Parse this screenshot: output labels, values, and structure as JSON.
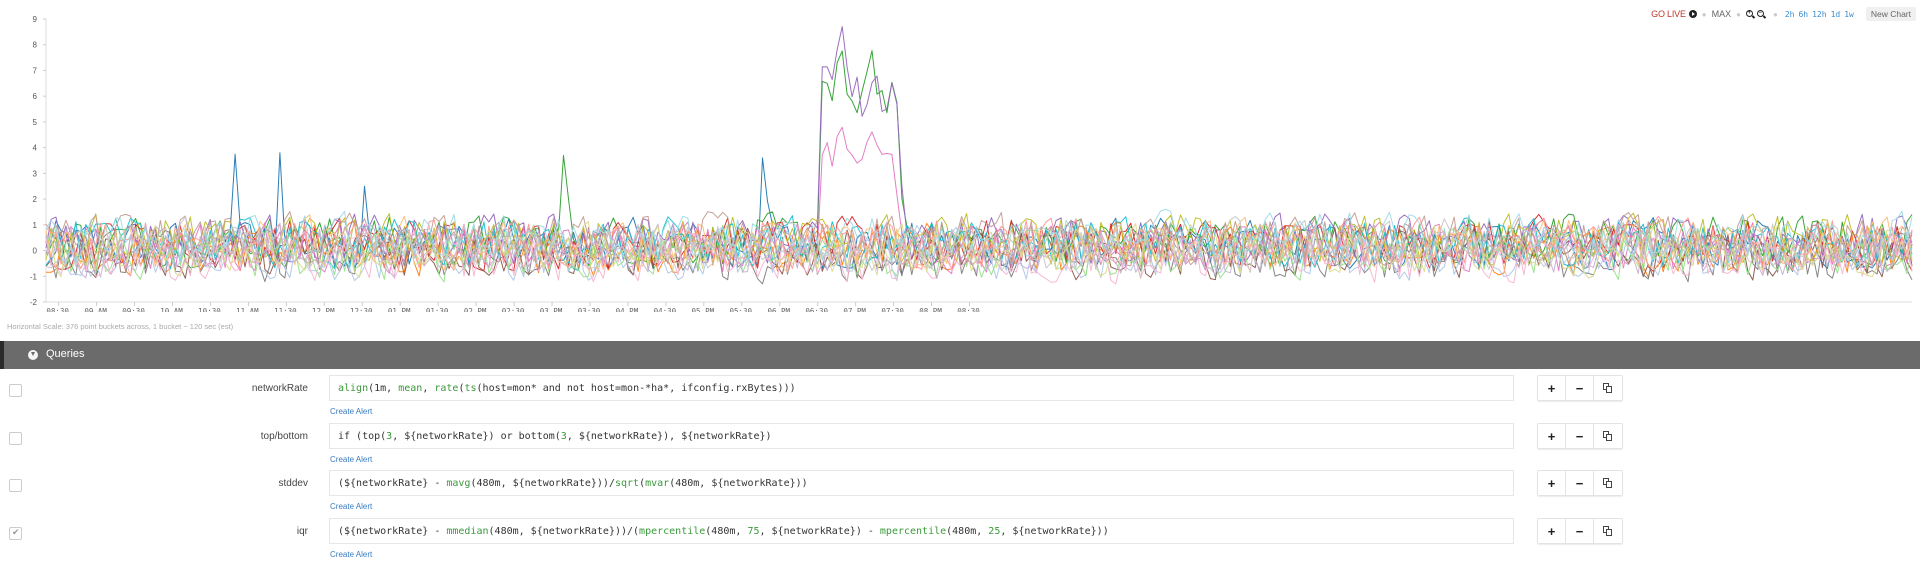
{
  "toolbar": {
    "go_live": "GO LIVE",
    "max": "MAX",
    "ranges": [
      "2h",
      "6h",
      "12h",
      "1d",
      "1w"
    ],
    "new_chart": "New Chart",
    "colors": {
      "go_live": "#c0392b",
      "range_link": "#3a8ccf"
    }
  },
  "chart_data": {
    "type": "line",
    "title": "",
    "xlabel": "",
    "ylabel": "",
    "ylim": [
      -2,
      9
    ],
    "yticks": [
      "-2",
      "-1",
      "0",
      "1",
      "2",
      "3",
      "4",
      "5",
      "6",
      "7",
      "8",
      "9"
    ],
    "x_range": [
      "08:20",
      "20:55"
    ],
    "xticks": [
      "08:30",
      "09 AM",
      "09:30",
      "10 AM",
      "10:30",
      "11 AM",
      "11:30",
      "12 PM",
      "12:30",
      "01 PM",
      "01:30",
      "02 PM",
      "02:30",
      "03 PM",
      "03:30",
      "04 PM",
      "04:30",
      "05 PM",
      "05:30",
      "06 PM",
      "06:30",
      "07 PM",
      "07:30",
      "08 PM",
      "08:30"
    ],
    "grid": false,
    "legend": "none",
    "series_count": 20,
    "series_colors": [
      "#1f77b4",
      "#ff7f0e",
      "#2ca02c",
      "#d62728",
      "#9467bd",
      "#8c564b",
      "#e377c2",
      "#7f7f7f",
      "#bcbd22",
      "#17becf",
      "#aec7e8",
      "#ffbb78",
      "#98df8a",
      "#ff9896",
      "#c5b0d5",
      "#c49c94",
      "#f7b6d2",
      "#c7c7c7",
      "#dbdb8d",
      "#9edae5"
    ],
    "noise_band": [
      -1.3,
      2.5
    ],
    "notable_spikes": [
      {
        "time": "10:50",
        "value": 3.75,
        "series": 0
      },
      {
        "time": "11:25",
        "value": 3.8,
        "series": 0
      },
      {
        "time": "12:30",
        "value": 2.5,
        "series": 0
      },
      {
        "time": "03:10",
        "value": 3.7,
        "series": 2
      },
      {
        "time": "05:45",
        "value": 3.6,
        "series": 0
      }
    ],
    "anomaly_window": [
      "06:30",
      "07:35"
    ],
    "anomaly_series": [
      {
        "series": 4,
        "values": [
          1.5,
          7.1,
          7.6,
          6.8,
          6.5,
          6.7,
          8.9,
          8.5,
          7.2,
          6.3,
          5.9,
          6.8,
          5.3,
          5.1,
          5.9,
          6.2,
          7.4,
          6.1,
          5.5,
          5.3,
          5.7,
          6.6,
          6.6,
          1.0
        ]
      },
      {
        "series": 2,
        "values": [
          1.0,
          6.8,
          5.9,
          6.6,
          5.8,
          5.9,
          8.9,
          7.4,
          6.3,
          5.4,
          6.0,
          5.2,
          6.3,
          6.1,
          7.2,
          8.1,
          7.1,
          5.5,
          6.1,
          5.3,
          5.8,
          6.6,
          6.6,
          1.0
        ]
      },
      {
        "series": 6,
        "values": [
          0.6,
          3.5,
          3.9,
          4.3,
          3.4,
          3.7,
          5.1,
          4.7,
          3.9,
          3.5,
          3.6,
          3.3,
          3.8,
          3.5,
          4.3,
          4.8,
          4.0,
          4.2,
          3.6,
          3.4,
          4.1,
          3.6,
          2.3,
          0.5
        ]
      }
    ]
  },
  "horizontal_scale": "Horizontal Scale: 376 point buckets across, 1 bucket ~ 120 sec (est)",
  "queries": {
    "title": "Queries",
    "create_alert": "Create Alert",
    "items": [
      {
        "name": "networkRate",
        "checked": false,
        "tokens": [
          [
            "fn",
            "align"
          ],
          [
            "t",
            "(1m, "
          ],
          [
            "fn",
            "mean"
          ],
          [
            "t",
            ", "
          ],
          [
            "fn",
            "rate"
          ],
          [
            "t",
            "("
          ],
          [
            "fn",
            "ts"
          ],
          [
            "t",
            "(host=mon* and not host=mon-*ha*, ifconfig.rxBytes)))"
          ]
        ]
      },
      {
        "name": "top/bottom",
        "checked": false,
        "tokens": [
          [
            "t",
            "if (top("
          ],
          [
            "num",
            "3"
          ],
          [
            "t",
            ", ${networkRate}) or bottom("
          ],
          [
            "num",
            "3"
          ],
          [
            "t",
            ", ${networkRate}), ${networkRate})"
          ]
        ]
      },
      {
        "name": "stddev",
        "checked": false,
        "tokens": [
          [
            "t",
            "(${networkRate} - "
          ],
          [
            "fn",
            "mavg"
          ],
          [
            "t",
            "(480m, ${networkRate}))/"
          ],
          [
            "fn",
            "sqrt"
          ],
          [
            "t",
            "("
          ],
          [
            "fn",
            "mvar"
          ],
          [
            "t",
            "(480m, ${networkRate}))"
          ]
        ]
      },
      {
        "name": "iqr",
        "checked": true,
        "tokens": [
          [
            "t",
            "(${networkRate} - "
          ],
          [
            "fn",
            "mmedian"
          ],
          [
            "t",
            "(480m, ${networkRate}))/("
          ],
          [
            "fn",
            "mpercentile"
          ],
          [
            "t",
            "(480m, "
          ],
          [
            "num",
            "75"
          ],
          [
            "t",
            ", ${networkRate}) - "
          ],
          [
            "fn",
            "mpercentile"
          ],
          [
            "t",
            "(480m, "
          ],
          [
            "num",
            "25"
          ],
          [
            "t",
            ", ${networkRate}))"
          ]
        ]
      }
    ],
    "row_buttons": {
      "add": "+",
      "remove": "−"
    }
  }
}
